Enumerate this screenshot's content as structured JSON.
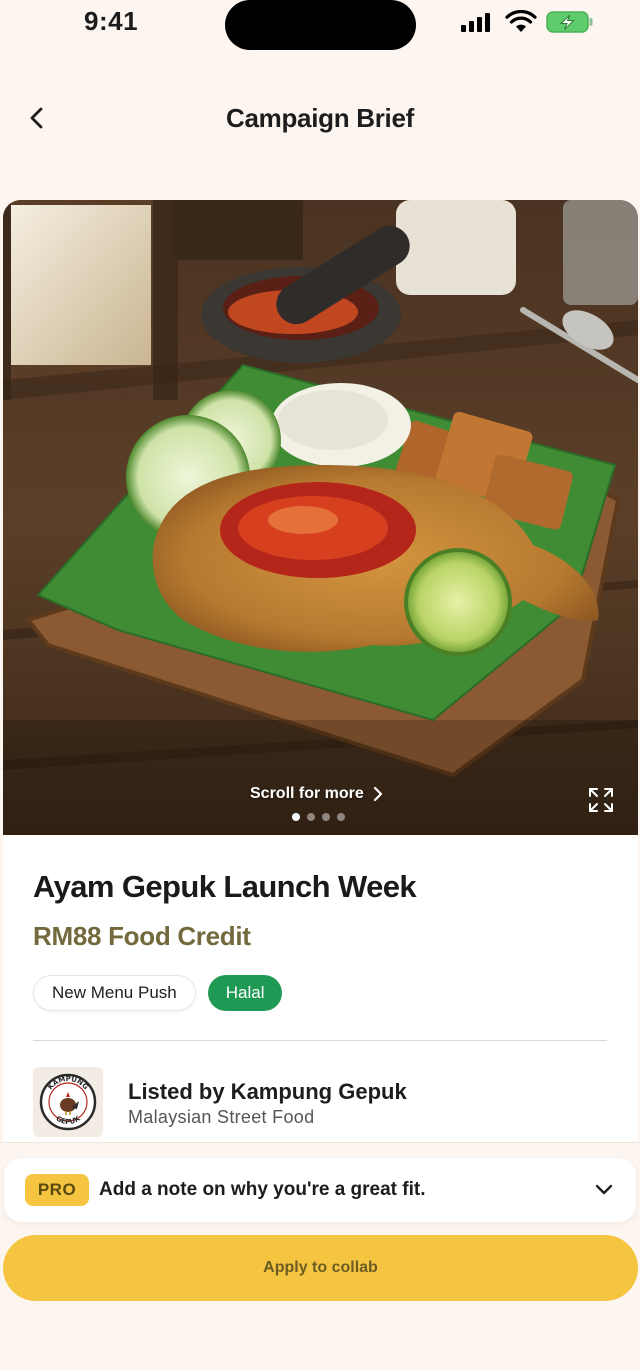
{
  "status_bar": {
    "time": "9:41"
  },
  "nav": {
    "title": "Campaign Brief"
  },
  "hero": {
    "scroll_label": "Scroll for more",
    "slide_count": 4,
    "active_slide": 1
  },
  "campaign": {
    "title": "Ayam Gepuk Launch Week",
    "reward": "RM88 Food Credit",
    "tags": [
      "New Menu Push",
      "Halal"
    ],
    "merchant": {
      "name": "Listed by Kampung Gepuk",
      "category": "Malaysian Street Food",
      "logo_text_top": "KAMPUNG",
      "logo_text_bottom": "GEPUK"
    }
  },
  "note": {
    "badge": "PRO",
    "text": "Add a note on why you're a great fit."
  },
  "cta": {
    "label": "Apply to collab"
  },
  "colors": {
    "accent_yellow": "#f5c542",
    "halal_green": "#1f9a55",
    "reward_olive": "#726a3c",
    "background": "#fdf6f0"
  }
}
